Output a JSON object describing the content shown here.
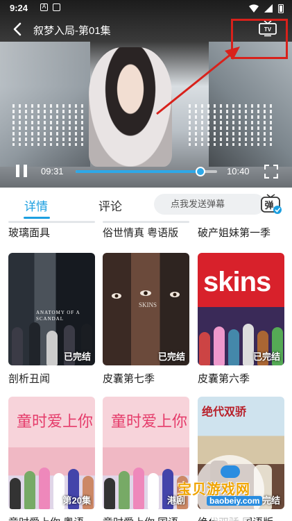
{
  "status_bar": {
    "time": "9:24"
  },
  "player": {
    "title": "叙梦入局-第01集",
    "current_time": "09:31",
    "duration": "10:40",
    "progress": 0.88
  },
  "tabs": {
    "details": "详情",
    "comments": "评论"
  },
  "danmaku": {
    "placeholder": "点我发送弹幕",
    "button": "弹"
  },
  "prev_row": [
    "玻璃面具",
    "俗世情真 粤语版",
    "破产姐妹第一季"
  ],
  "cards": [
    {
      "title": "剖析丑闻",
      "badge": "已完结",
      "poster_text": "ANATOMY OF A SCANDAL"
    },
    {
      "title": "皮囊第七季",
      "badge": "已完结",
      "poster_text": "SKINS"
    },
    {
      "title": "皮囊第六季",
      "badge": "已完结",
      "poster_text": "skins"
    },
    {
      "title": "童时爱上你 粤语",
      "badge": "第20集",
      "poster_text": "童时爱上你"
    },
    {
      "title": "童时爱上你 国语",
      "badge": "港剧",
      "poster_text": "童时爱上你"
    },
    {
      "title": "绝代双骄 国语版",
      "badge": "已完结",
      "poster_text": "绝代双骄"
    }
  ],
  "watermark": {
    "text": "宝贝游戏网",
    "url": "baobeiy.com"
  },
  "colors": {
    "accent": "#1c9fe0",
    "annotation": "#d8211b"
  },
  "icons": [
    "back-icon",
    "tv-cast-icon",
    "pause-icon",
    "fullscreen-icon",
    "danmaku-toggle-icon"
  ]
}
